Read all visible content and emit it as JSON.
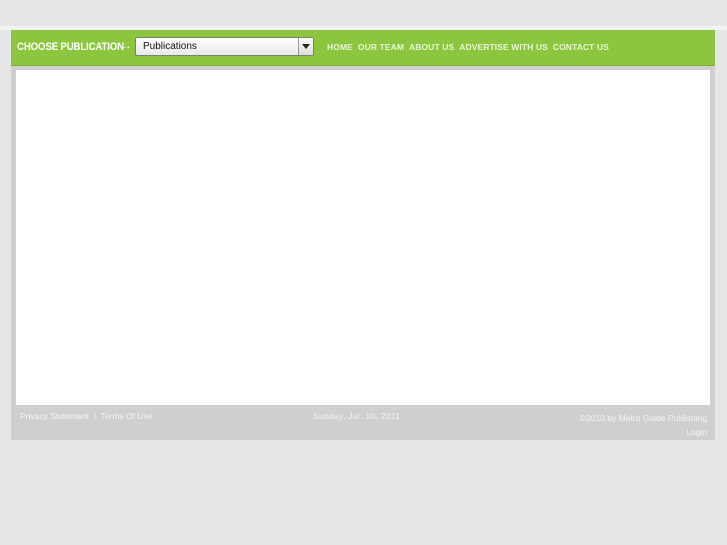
{
  "header": {
    "choose_label": "CHOOSE PUBLICATION",
    "arrow": "→",
    "publication_select": {
      "value": "Publications"
    },
    "nav": [
      {
        "label": "HOME"
      },
      {
        "label": "OUR TEAM"
      },
      {
        "label": "ABOUT US"
      },
      {
        "label": "ADVERTISE WITH US"
      },
      {
        "label": "CONTACT US"
      }
    ]
  },
  "footer": {
    "privacy": "Privacy Statement",
    "separator": "|",
    "terms": "Terms Of Use",
    "date": "Sunday, Jul. 10, 2011",
    "copyright": "©2010 by Metro Guide Publishing",
    "login": "Login"
  },
  "colors": {
    "header_green": "#8cc63f",
    "background": "#e6e6e6",
    "footer_gray": "#cfcfcf"
  }
}
